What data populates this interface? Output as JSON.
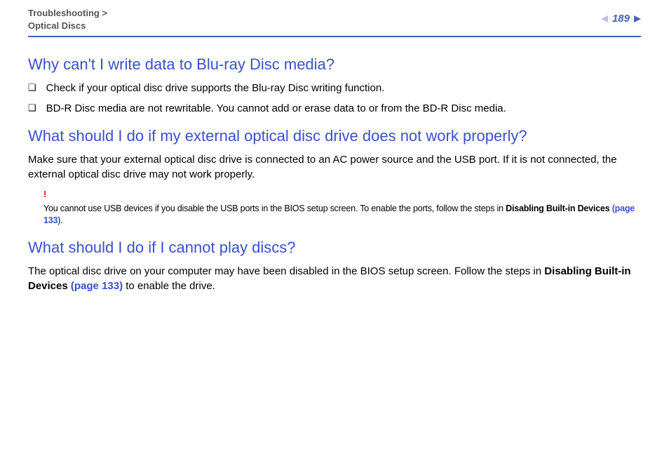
{
  "header": {
    "breadcrumb_line1": "Troubleshooting >",
    "breadcrumb_line2": "Optical Discs",
    "page_number": "189"
  },
  "section1": {
    "heading": "Why can't I write data to Blu-ray Disc media?",
    "bullets": [
      "Check if your optical disc drive supports the Blu-ray Disc writing function.",
      "BD-R Disc media are not rewritable. You cannot add or erase data to or from the BD-R Disc media."
    ]
  },
  "section2": {
    "heading": "What should I do if my external optical disc drive does not work properly?",
    "body": "Make sure that your external optical disc drive is connected to an AC power source and the USB port. If it is not connected, the external optical disc drive may not work properly.",
    "note_mark": "!",
    "note_pre": "You cannot use USB devices if you disable the USB ports in the BIOS setup screen. To enable the ports, follow the steps in ",
    "note_bold1": "Disabling Built-in Devices ",
    "note_link": "(page 133)",
    "note_post": "."
  },
  "section3": {
    "heading": "What should I do if I cannot play discs?",
    "body_pre": "The optical disc drive on your computer may have been disabled in the BIOS setup screen. Follow the steps in ",
    "body_bold1": "Disabling Built-in Devices ",
    "body_link": "(page 133)",
    "body_post": " to enable the drive."
  }
}
